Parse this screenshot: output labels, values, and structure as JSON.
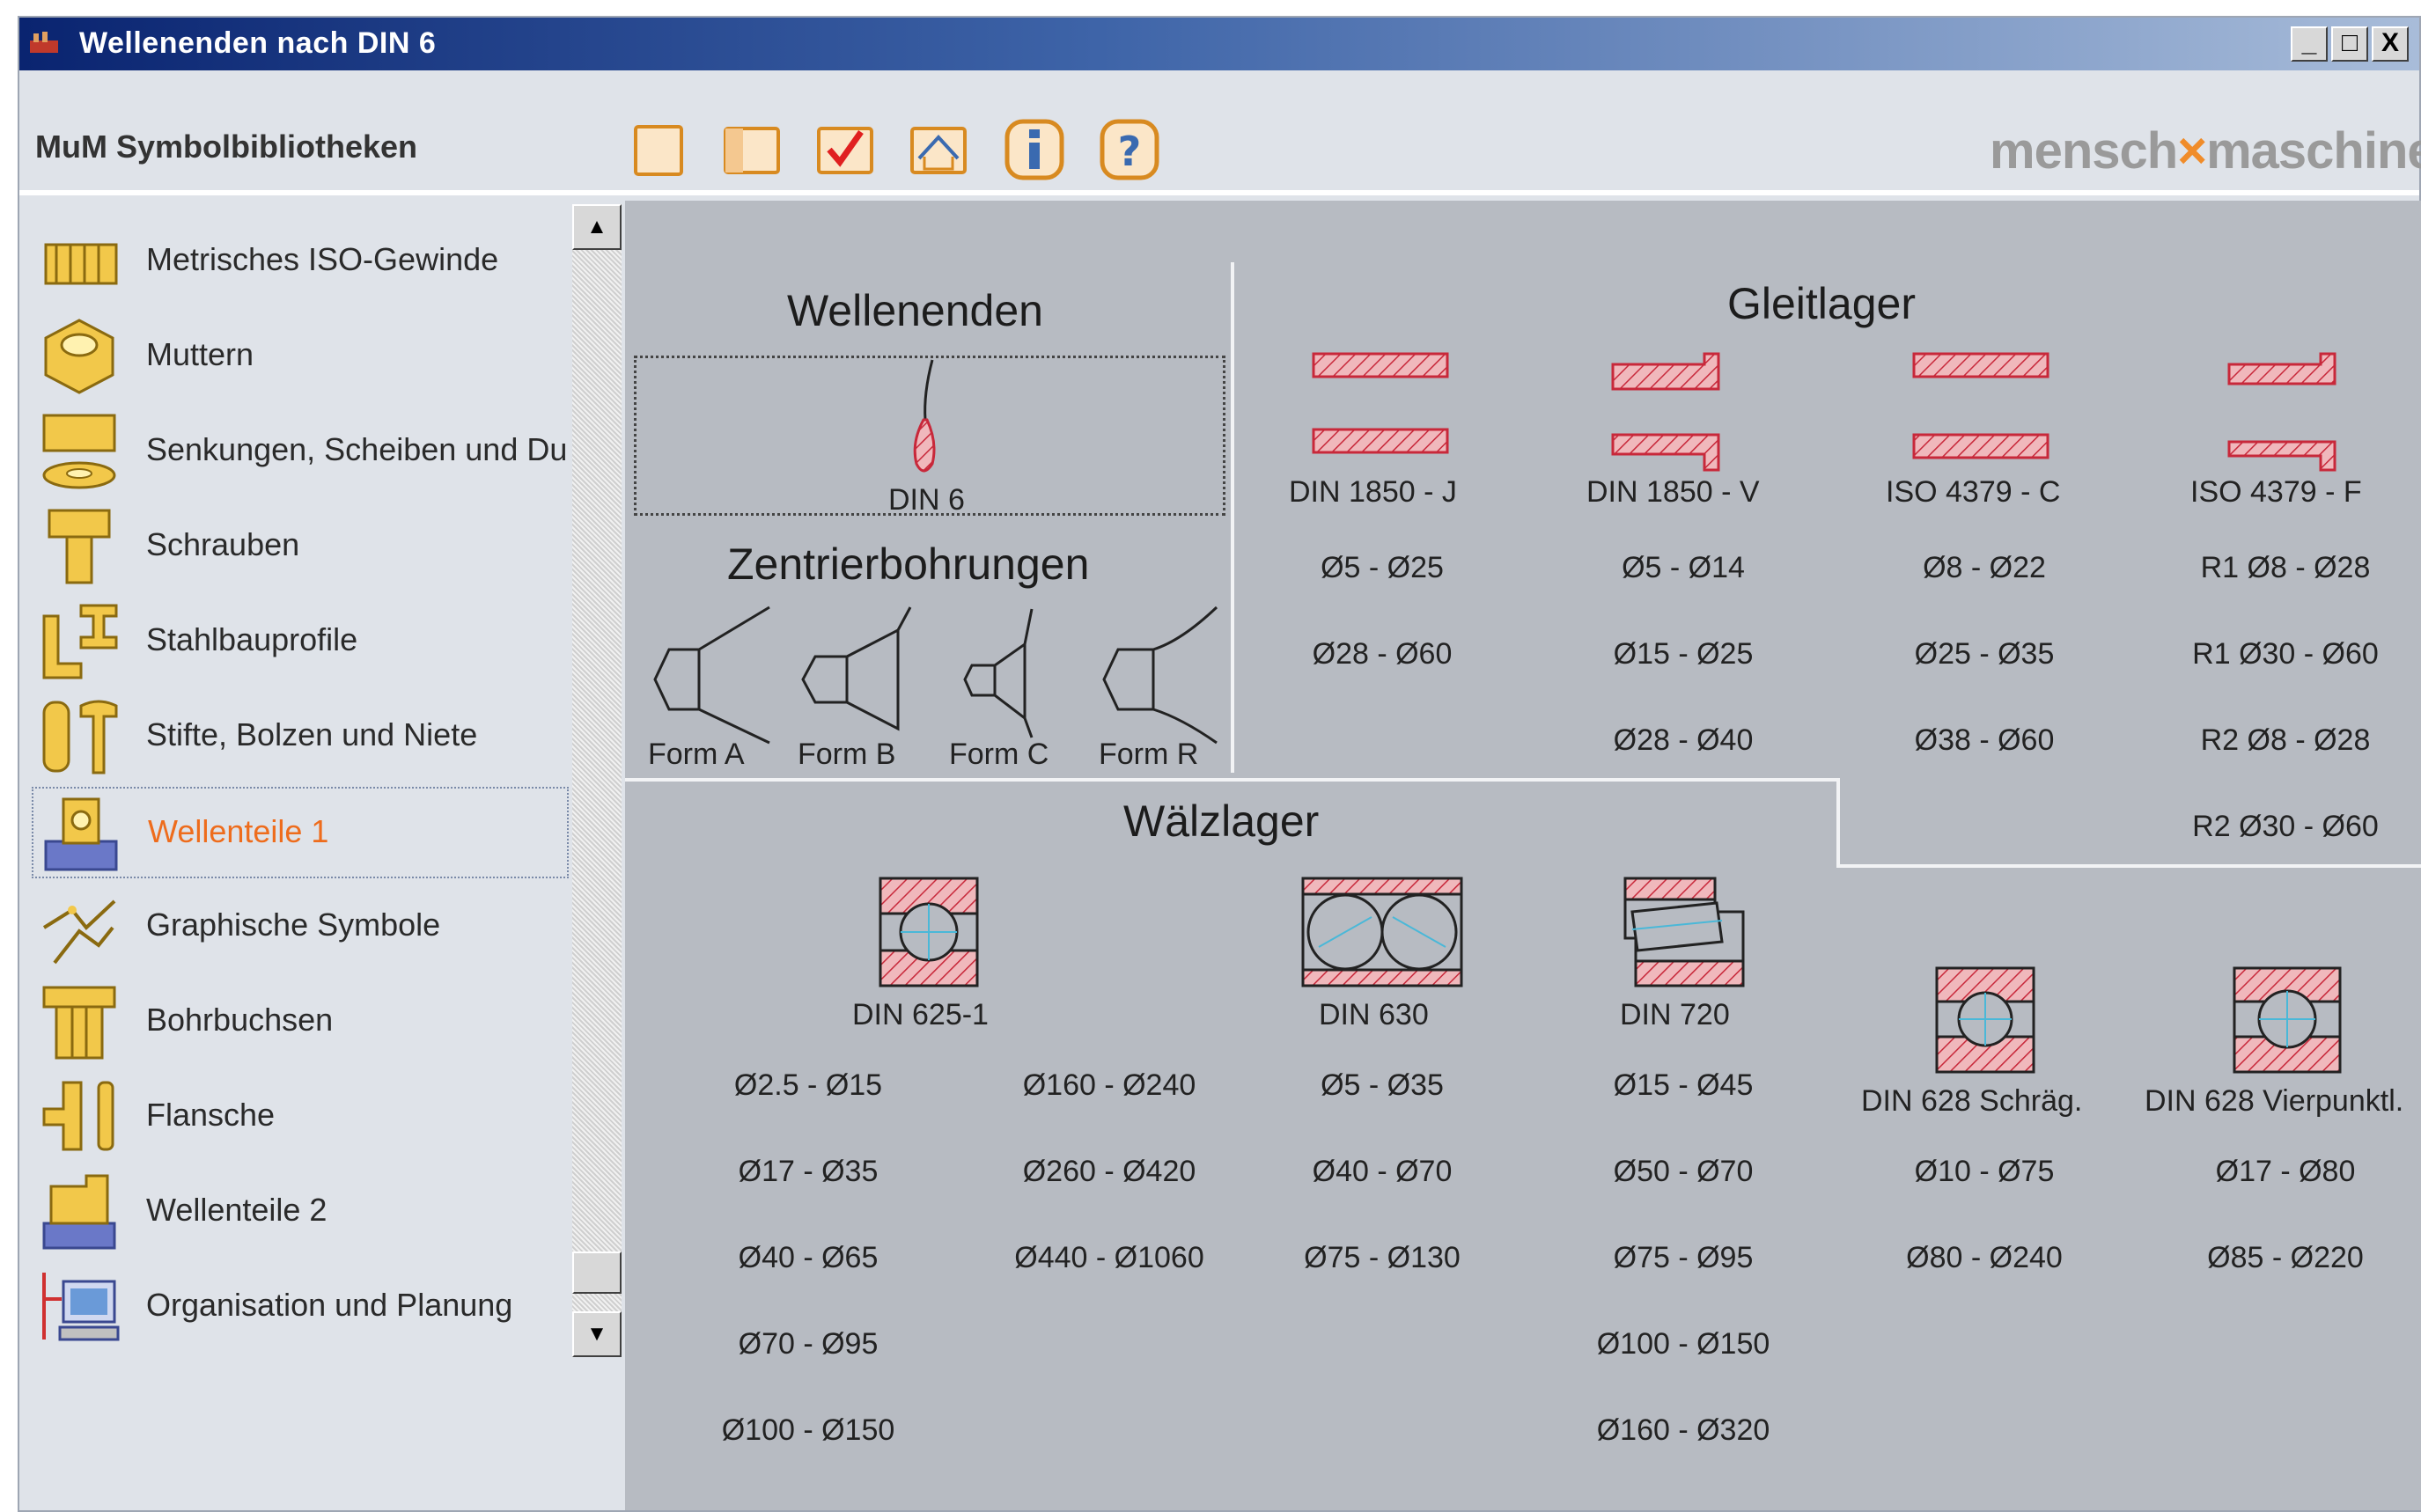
{
  "window": {
    "title": "Wellenenden nach DIN 6",
    "minimize": "_",
    "maximize": "□",
    "close": "X"
  },
  "toolbar": {
    "library_title": "MuM Symbolbibliotheken",
    "brand_left": "mensch",
    "brand_right": "maschine",
    "buttons": [
      "new-icon",
      "window-icon",
      "check-icon",
      "house-icon",
      "info-icon",
      "help-icon"
    ]
  },
  "sidebar": {
    "items": [
      {
        "label": "Metrisches ISO-Gewinde",
        "icon": "thread-icon"
      },
      {
        "label": "Muttern",
        "icon": "nut-icon"
      },
      {
        "label": "Senkungen, Scheiben und Du",
        "icon": "washer-icon"
      },
      {
        "label": "Schrauben",
        "icon": "screw-icon"
      },
      {
        "label": "Stahlbauprofile",
        "icon": "steel-profile-icon"
      },
      {
        "label": "Stifte, Bolzen und Niete",
        "icon": "pin-icon"
      },
      {
        "label": "Wellenteile 1",
        "icon": "shaft-part-icon",
        "active": true
      },
      {
        "label": "Graphische Symbole",
        "icon": "graphic-symbol-icon"
      },
      {
        "label": "Bohrbuchsen",
        "icon": "drill-bush-icon"
      },
      {
        "label": "Flansche",
        "icon": "flange-icon"
      },
      {
        "label": "Wellenteile 2",
        "icon": "shaft-part-2-icon"
      },
      {
        "label": "Organisation und Planung",
        "icon": "computer-icon"
      }
    ]
  },
  "content": {
    "wellenenden": {
      "heading": "Wellenenden",
      "item": "DIN 6"
    },
    "zentrier": {
      "heading": "Zentrierbohrungen",
      "forms": [
        "Form A",
        "Form B",
        "Form C",
        "Form R"
      ]
    },
    "gleitlager": {
      "heading": "Gleitlager",
      "columns": [
        {
          "label": "DIN 1850 - J",
          "ranges": [
            "Ø5 - Ø25",
            "Ø28 - Ø60"
          ]
        },
        {
          "label": "DIN 1850 - V",
          "ranges": [
            "Ø5 - Ø14",
            "Ø15 - Ø25",
            "Ø28 - Ø40"
          ]
        },
        {
          "label": "ISO 4379 - C",
          "ranges": [
            "Ø8 - Ø22",
            "Ø25 - Ø35",
            "Ø38 - Ø60"
          ]
        },
        {
          "label": "ISO 4379 - F",
          "ranges": [
            "R1 Ø8 - Ø28",
            "R1 Ø30 - Ø60",
            "R2 Ø8 - Ø28",
            "R2 Ø30 - Ø60"
          ]
        }
      ]
    },
    "waelzlager": {
      "heading": "Wälzlager",
      "din625_label": "DIN 625-1",
      "din625_col1": [
        "Ø2.5 - Ø15",
        "Ø17 - Ø35",
        "Ø40 - Ø65",
        "Ø70 - Ø95",
        "Ø100 - Ø150"
      ],
      "din625_col2": [
        "Ø160 - Ø240",
        "Ø260 - Ø420",
        "Ø440 - Ø1060"
      ],
      "din630": {
        "label": "DIN 630",
        "ranges": [
          "Ø5 - Ø35",
          "Ø40 - Ø70",
          "Ø75 - Ø130"
        ]
      },
      "din720": {
        "label": "DIN 720",
        "ranges": [
          "Ø15 - Ø45",
          "Ø50 - Ø70",
          "Ø75 - Ø95",
          "Ø100 - Ø150",
          "Ø160 - Ø320"
        ]
      },
      "din628s": {
        "label": "DIN 628 Schräg.",
        "ranges": [
          "Ø10 - Ø75",
          "Ø80 - Ø240"
        ]
      },
      "din628v": {
        "label": "DIN 628 Vierpunktl.",
        "ranges": [
          "Ø17 - Ø80",
          "Ø85 - Ø220"
        ]
      }
    }
  },
  "colors": {
    "accent": "#ee6c1c",
    "hatch": "#c8283a",
    "panel": "#b7bbc2"
  }
}
